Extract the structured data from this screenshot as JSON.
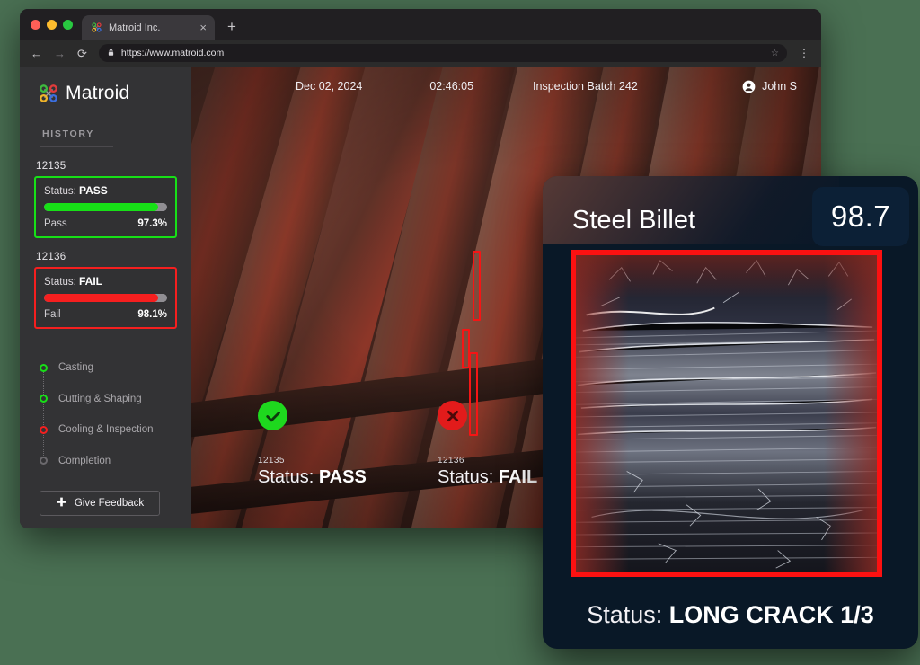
{
  "browser": {
    "tab": {
      "title": "Matroid Inc.",
      "favicon": "matroid-logo-icon",
      "close": "×"
    },
    "new_tab": "+",
    "nav": {
      "back": "←",
      "forward": "→",
      "reload": "⟳",
      "menu": "⋮"
    },
    "omnibox": {
      "lock": "lock-icon",
      "url": "https://www.matroid.com",
      "star": "☆"
    }
  },
  "sidebar": {
    "brand": "Matroid",
    "history_label": "HISTORY",
    "entries": [
      {
        "id": "12135",
        "status_label": "Status:",
        "status_value": "PASS",
        "result_label": "Pass",
        "percent": "97.3%",
        "progress": 93,
        "color": "#17e017"
      },
      {
        "id": "12136",
        "status_label": "Status:",
        "status_value": "FAIL",
        "result_label": "Fail",
        "percent": "98.1%",
        "progress": 93,
        "color": "#f51f1f"
      }
    ],
    "steps": [
      {
        "label": "Casting",
        "state": "ok"
      },
      {
        "label": "Cutting & Shaping",
        "state": "ok"
      },
      {
        "label": "Cooling & Inspection",
        "state": "bad"
      },
      {
        "label": "Completion",
        "state": "pending"
      }
    ],
    "feedback_button": {
      "icon": "plus-icon",
      "label": "Give Feedback"
    }
  },
  "topbar": {
    "date": "Dec 02, 2024",
    "time": "02:46:05",
    "batch": "Inspection Batch 242",
    "user": "John S",
    "user_icon": "account-circle-icon"
  },
  "stage": {
    "verdicts": [
      {
        "id": "12135",
        "badge": "check-icon",
        "status_label": "Status:",
        "status_value": "PASS",
        "color": "#1ed81e"
      },
      {
        "id": "12136",
        "badge": "cross-icon",
        "status_label": "Status:",
        "status_value": "FAIL",
        "color": "#e21b1b"
      }
    ],
    "detection_boxes": 3,
    "detection_color": "#f51515"
  },
  "panel": {
    "title": "Steel Billet",
    "score": "98.7",
    "status_label": "Status:",
    "status_value": "LONG CRACK 1/3",
    "frame_color": "#fc1111",
    "background": "#091827"
  }
}
